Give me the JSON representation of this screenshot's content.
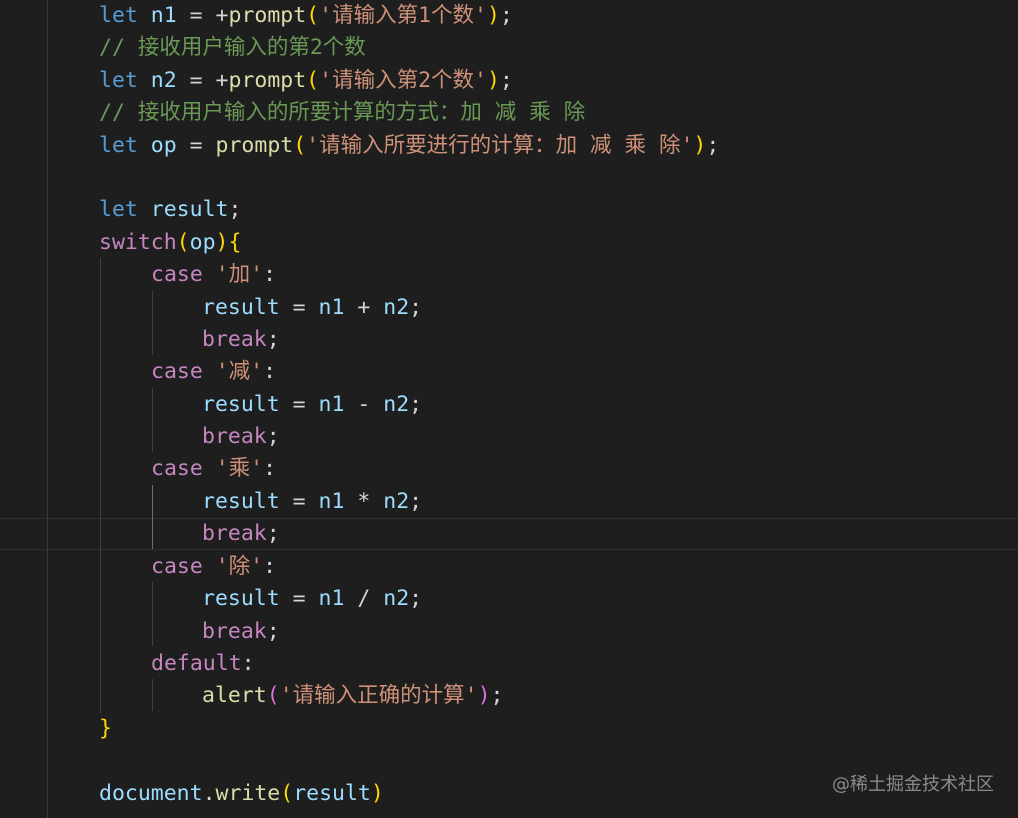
{
  "editor": {
    "language": "javascript",
    "theme": "dark",
    "active_line": 16,
    "colors": {
      "background": "#1e1e1e",
      "keyword": "#569cd6",
      "control": "#c586c0",
      "variable": "#9cdcfe",
      "function": "#dcdcaa",
      "string": "#ce9178",
      "comment": "#6a9955",
      "bracket_gold": "#ffd700",
      "bracket_purple": "#da70d6"
    },
    "lines": [
      {
        "kw": "let",
        "name": "n1",
        "eq": "=",
        "plus": "+",
        "fn": "prompt",
        "open": "(",
        "str": "'请输入第1个数'",
        "close": ")",
        "semi": ";"
      },
      {
        "comment": "// 接收用户输入的第2个数"
      },
      {
        "kw": "let",
        "name": "n2",
        "eq": "=",
        "plus": "+",
        "fn": "prompt",
        "open": "(",
        "str": "'请输入第2个数'",
        "close": ")",
        "semi": ";"
      },
      {
        "comment": "// 接收用户输入的所要计算的方式：加 减 乘 除"
      },
      {
        "kw": "let",
        "name": "op",
        "eq": "=",
        "fn": "prompt",
        "open": "(",
        "str": "'请输入所要进行的计算：加 减 乘 除'",
        "close": ")",
        "semi": ";"
      },
      {},
      {
        "kw": "let",
        "name": "result",
        "semi": ";"
      },
      {
        "ctl": "switch",
        "open": "(",
        "var": "op",
        "close": ")",
        "brace": "{"
      },
      {
        "ctl": "case",
        "str": "'加'",
        "colon": ":"
      },
      {
        "var": "result",
        "eq": "=",
        "a": "n1",
        "op": "+",
        "b": "n2",
        "semi": ";"
      },
      {
        "ctl": "break",
        "semi": ";"
      },
      {
        "ctl": "case",
        "str": "'减'",
        "colon": ":"
      },
      {
        "var": "result",
        "eq": "=",
        "a": "n1",
        "op": "-",
        "b": "n2",
        "semi": ";"
      },
      {
        "ctl": "break",
        "semi": ";"
      },
      {
        "ctl": "case",
        "str": "'乘'",
        "colon": ":"
      },
      {
        "var": "result",
        "eq": "=",
        "a": "n1",
        "op": "*",
        "b": "n2",
        "semi": ";"
      },
      {
        "ctl": "break",
        "semi": ";"
      },
      {
        "ctl": "case",
        "str": "'除'",
        "colon": ":"
      },
      {
        "var": "result",
        "eq": "=",
        "a": "n1",
        "op": "/",
        "b": "n2",
        "semi": ";"
      },
      {
        "ctl": "break",
        "semi": ";"
      },
      {
        "ctl": "default",
        "colon": ":"
      },
      {
        "fn": "alert",
        "open": "(",
        "str": "'请输入正确的计算'",
        "close": ")",
        "semi": ";"
      },
      {
        "brace": "}"
      },
      {},
      {
        "var": "document",
        "dot": ".",
        "fn": "write",
        "open": "(",
        "arg": "result",
        "close": ")"
      }
    ]
  },
  "watermark": "@稀土掘金技术社区"
}
